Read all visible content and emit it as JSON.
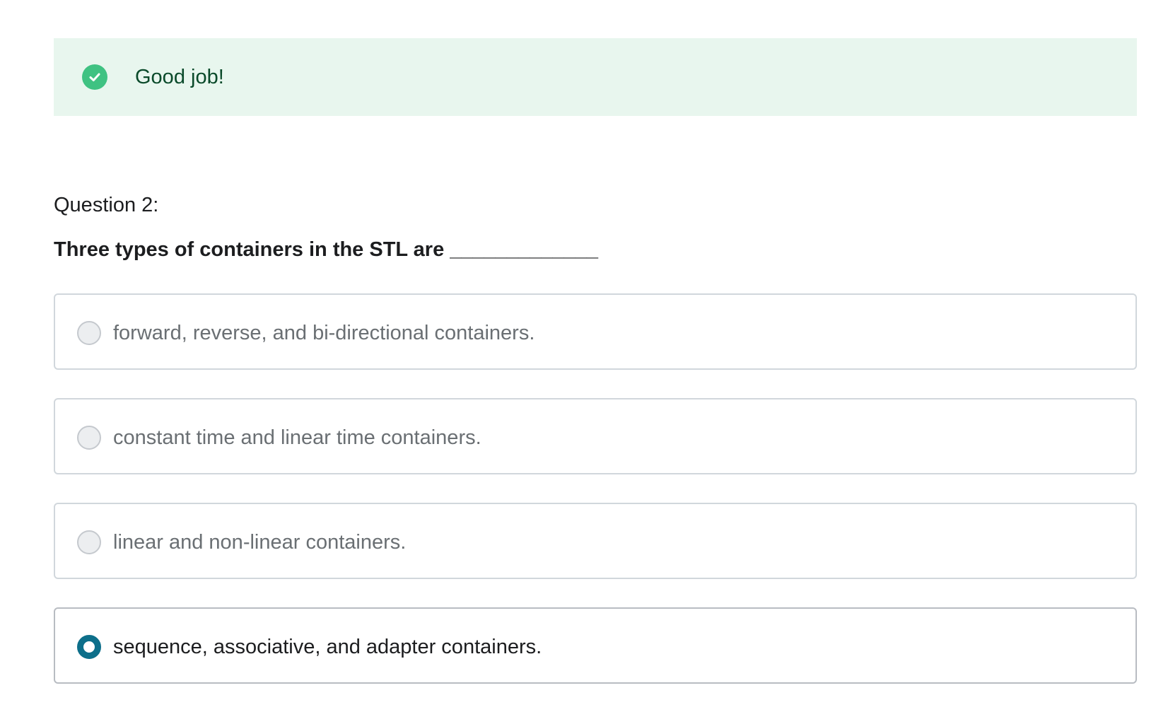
{
  "feedback": {
    "icon": "check-circle-icon",
    "message": "Good job!",
    "colors": {
      "background": "#e8f6ee",
      "icon": "#3fc282",
      "text": "#0a4a2a"
    }
  },
  "question": {
    "label": "Question 2:",
    "prompt": "Three types of containers in the STL are _____________",
    "options": [
      {
        "label": "forward, reverse, and bi-directional containers.",
        "selected": false
      },
      {
        "label": "constant time and linear time containers.",
        "selected": false
      },
      {
        "label": "linear and non-linear containers.",
        "selected": false
      },
      {
        "label": "sequence, associative, and adapter containers.",
        "selected": true
      }
    ],
    "accent_color": "#0d6f8a"
  }
}
